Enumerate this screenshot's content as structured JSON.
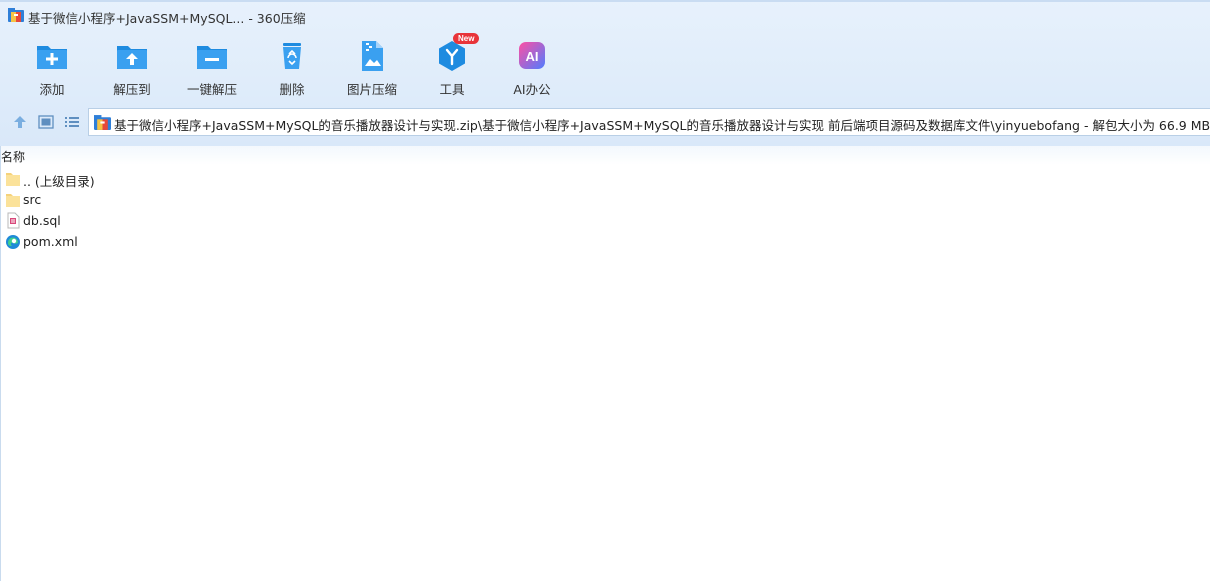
{
  "window": {
    "title": "基于微信小程序+JavaSSM+MySQL... - 360压缩"
  },
  "toolbar": {
    "add_label": "添加",
    "extract_to_label": "解压到",
    "one_click_extract_label": "一键解压",
    "delete_label": "删除",
    "image_compress_label": "图片压缩",
    "tools_label": "工具",
    "tools_badge": "New",
    "ai_office_label": "AI办公",
    "ai_icon_text": "AI"
  },
  "address": {
    "path": "基于微信小程序+JavaSSM+MySQL的音乐播放器设计与实现.zip\\基于微信小程序+JavaSSM+MySQL的音乐播放器设计与实现 前后端项目源码及数据库文件\\yinyuebofang - 解包大小为 66.9 MB"
  },
  "list": {
    "column_name": "名称",
    "items": [
      {
        "name": ".. (上级目录)",
        "icon": "folder-icon"
      },
      {
        "name": "src",
        "icon": "folder-icon"
      },
      {
        "name": "db.sql",
        "icon": "sql-file-icon"
      },
      {
        "name": "pom.xml",
        "icon": "edge-xml-icon"
      }
    ]
  },
  "colors": {
    "chrome_bg": "#dfecfa",
    "tool_blue": "#1e8be0",
    "badge_red": "#e8343a",
    "ai_gradient_start": "#ff4fa3",
    "ai_gradient_end": "#4f7cff"
  }
}
